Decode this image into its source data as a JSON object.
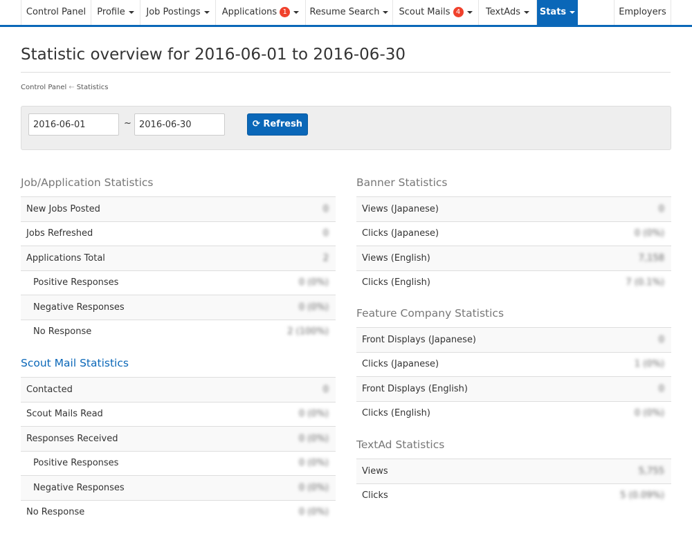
{
  "nav": {
    "items": [
      {
        "label": "Control Panel",
        "caret": false
      },
      {
        "label": "Profile",
        "caret": true
      },
      {
        "label": "Job Postings",
        "caret": true
      },
      {
        "label": "Applications",
        "caret": true,
        "badge": "1"
      },
      {
        "label": "Resume Search",
        "caret": true
      },
      {
        "label": "Scout Mails",
        "caret": true,
        "badge": "4"
      },
      {
        "label": "TextAds",
        "caret": true
      },
      {
        "label": "Stats",
        "caret": true,
        "active": true
      },
      {
        "label": "Employers",
        "caret": false
      }
    ],
    "accent": "#0a67b8",
    "badge_color": "#f0412c"
  },
  "page": {
    "title": "Statistic overview for 2016-06-01 to 2016-06-30"
  },
  "breadcrumb": {
    "items": [
      "Control Panel",
      "Statistics"
    ],
    "separator": "←"
  },
  "filter": {
    "from": "2016-06-01",
    "separator": "~",
    "to": "2016-06-30",
    "refresh_label": "Refresh",
    "refresh_icon": "refresh-icon"
  },
  "sections": {
    "job": {
      "title": "Job/Application Statistics",
      "rows": [
        {
          "label": "New Jobs Posted",
          "value": "0"
        },
        {
          "label": "Jobs Refreshed",
          "value": "0"
        },
        {
          "label": "Applications Total",
          "value": "2"
        },
        {
          "label": "Positive Responses",
          "value": "0 (0%)",
          "indent": true
        },
        {
          "label": "Negative Responses",
          "value": "0 (0%)",
          "indent": true
        },
        {
          "label": "No Response",
          "value": "2 (100%)",
          "indent": true
        }
      ]
    },
    "scout": {
      "title": "Scout Mail Statistics",
      "rows": [
        {
          "label": "Contacted",
          "value": "0"
        },
        {
          "label": "Scout Mails Read",
          "value": "0 (0%)"
        },
        {
          "label": "Responses Received",
          "value": "0 (0%)"
        },
        {
          "label": "Positive Responses",
          "value": "0 (0%)",
          "indent": true
        },
        {
          "label": "Negative Responses",
          "value": "0 (0%)",
          "indent": true
        },
        {
          "label": "No Response",
          "value": "0 (0%)"
        }
      ]
    },
    "banner": {
      "title": "Banner Statistics",
      "rows": [
        {
          "label": "Views (Japanese)",
          "value": "0"
        },
        {
          "label": "Clicks (Japanese)",
          "value": "0 (0%)"
        },
        {
          "label": "Views (English)",
          "value": "7,158"
        },
        {
          "label": "Clicks (English)",
          "value": "7 (0.1%)"
        }
      ]
    },
    "feature": {
      "title": "Feature Company Statistics",
      "rows": [
        {
          "label": "Front Displays (Japanese)",
          "value": "0"
        },
        {
          "label": "Clicks (Japanese)",
          "value": "1 (0%)"
        },
        {
          "label": "Front Displays (English)",
          "value": "0"
        },
        {
          "label": "Clicks (English)",
          "value": "0 (0%)"
        }
      ]
    },
    "textad": {
      "title": "TextAd Statistics",
      "rows": [
        {
          "label": "Views",
          "value": "5,755"
        },
        {
          "label": "Clicks",
          "value": "5 (0.09%)"
        }
      ]
    }
  }
}
